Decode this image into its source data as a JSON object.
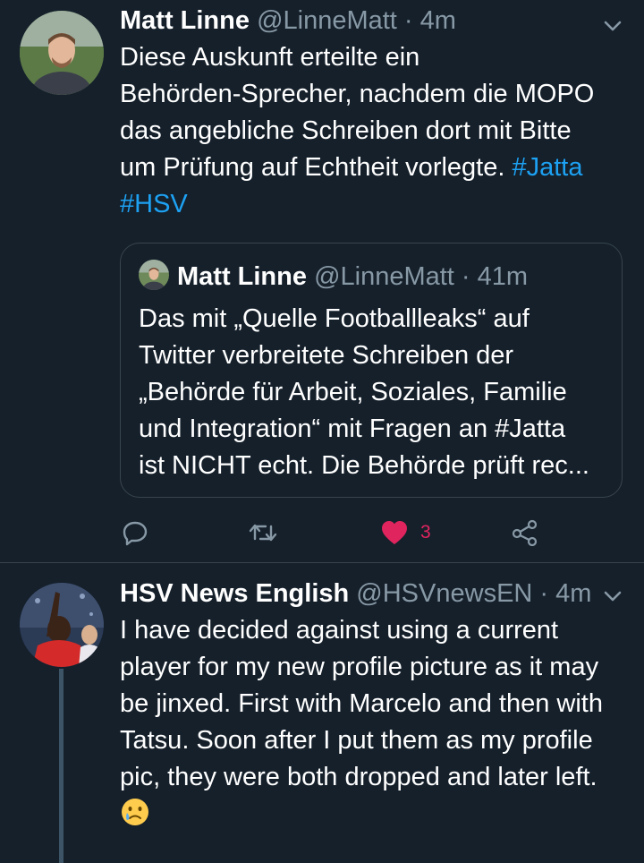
{
  "tweets": [
    {
      "name": "Matt Linne",
      "handle": "@LinneMatt",
      "dot": "·",
      "time": "4m",
      "text_lines": [
        "Diese Auskunft erteilte ein",
        "Behörden-Sprecher, nachdem die MOPO",
        "das angebliche Schreiben dort mit Bitte",
        "um Prüfung auf Echtheit vorlegte."
      ],
      "hashtags": [
        "#Jatta",
        "#HSV"
      ],
      "quote": {
        "name": "Matt Linne",
        "handle": "@LinneMatt",
        "dot": "·",
        "time": "41m",
        "text_lines": [
          "Das mit „Quelle Footballleaks“ auf",
          "Twitter verbreitete Schreiben der",
          "„Behörde für Arbeit, Soziales, Familie",
          "und Integration“ mit Fragen an #Jatta",
          "ist NICHT echt. Die Behörde prüft rec..."
        ]
      },
      "actions": {
        "reply_icon": "reply-icon",
        "retweet_icon": "retweet-icon",
        "like_icon": "heart-icon",
        "like_count": "3",
        "share_icon": "share-icon"
      }
    },
    {
      "name": "HSV News English",
      "handle": "@HSVnewsEN",
      "dot": "·",
      "time": "4m",
      "text_lines": [
        "I have decided against using a current",
        "player for my new profile picture as it may",
        "be jinxed. First with Marcelo and then with",
        "Tatsu. Soon after I put them as my profile",
        "pic, they were both dropped and later left."
      ],
      "emoji": "crying-face-emoji"
    }
  ],
  "colors": {
    "background": "#15202b",
    "secondary_text": "#8899a6",
    "link": "#1da1f2",
    "like": "#e0245e",
    "border": "#38444d"
  }
}
